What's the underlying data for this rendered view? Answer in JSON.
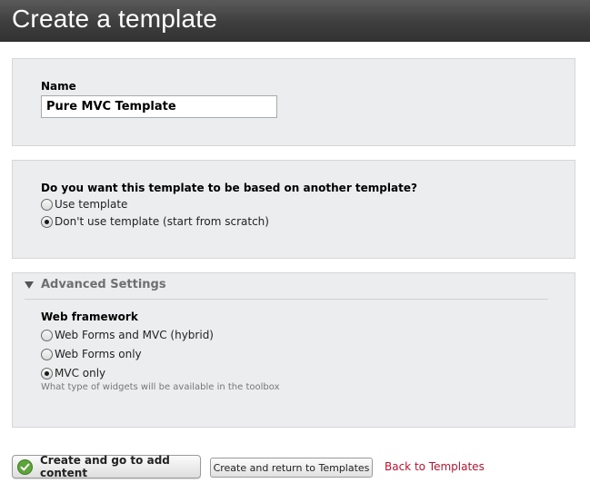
{
  "header": {
    "title": "Create a template"
  },
  "name_section": {
    "label": "Name",
    "value": "Pure MVC Template"
  },
  "template_section": {
    "question": "Do you want this template to be based on another template?",
    "options": [
      {
        "label": "Use template",
        "checked": false
      },
      {
        "label": "Don't use template (start from scratch)",
        "checked": true
      }
    ]
  },
  "advanced": {
    "title": "Advanced Settings",
    "framework_label": "Web framework",
    "options": [
      {
        "label": "Web Forms and MVC (hybrid)",
        "checked": false
      },
      {
        "label": "Web Forms only",
        "checked": false
      },
      {
        "label": "MVC only",
        "checked": true
      }
    ],
    "hint": "What type of widgets will be available in the toolbox"
  },
  "actions": {
    "primary_label": "Create and go to add content",
    "secondary_label": "Create and return to Templates",
    "back_link": "Back to Templates"
  },
  "colors": {
    "header_bg": "#3e3e3e",
    "panel_bg": "#ebedee",
    "link": "#c8102e",
    "check_green": "#5da43a"
  },
  "icons": {
    "primary_button_icon": "check-icon",
    "collapse_icon": "triangle-down-icon"
  }
}
